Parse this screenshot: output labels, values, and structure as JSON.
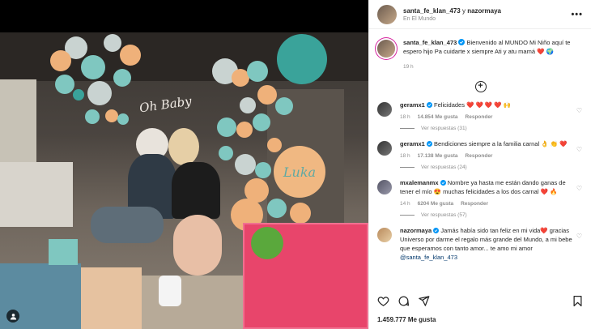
{
  "photo": {
    "sign_text": "Oh Baby",
    "balloon_name": "Luka"
  },
  "header": {
    "user_main": "santa_fe_klan_473",
    "joiner": "y",
    "user_collab": "nazormaya",
    "location": "En El Mundo",
    "more_icon": "more-horizontal-icon"
  },
  "caption": {
    "user": "santa_fe_klan_473",
    "verified_icon": "verified-badge-icon",
    "text": "Bienvenido al MUNDO Mi Niño aquí te espero hijo Pa cuidarte x siempre Ati y atu mamá ❤️ 🌍",
    "time": "19 h"
  },
  "load_more_icon": "plus-circle-icon",
  "comments": [
    {
      "user": "geramx1",
      "text": "Felicidades ❤️ ❤️ ❤️ ❤️ 🙌",
      "time": "18 h",
      "likes": "14.854 Me gusta",
      "reply": "Responder",
      "replies": "Ver respuestas (31)"
    },
    {
      "user": "geramx1",
      "text": "Bendiciones siempre a la familia carnal 👌 👏 ❤️",
      "time": "18 h",
      "likes": "17.138 Me gusta",
      "reply": "Responder",
      "replies": "Ver respuestas (24)"
    },
    {
      "user": "mxalemanmx",
      "text": "Nombre ya hasta me están dando ganas de tener el mío 😍 muchas felicidades a los dos carnal ❤️ 🔥",
      "time": "14 h",
      "likes": "6204 Me gusta",
      "reply": "Responder",
      "replies": "Ver respuestas (57)"
    },
    {
      "user": "nazormaya",
      "text": "Jamás había sido tan feliz en mi vida❤️ gracias Universo por darme el regalo más grande del Mundo, a mi bebe que esperamos con tanto amor... te amo mi amor",
      "mention": "@santa_fe_klan_473"
    }
  ],
  "actions": {
    "like_icon": "heart-icon",
    "comment_icon": "comment-icon",
    "share_icon": "share-icon",
    "save_icon": "bookmark-icon"
  },
  "likes_total": "1.459.777 Me gusta",
  "colors": {
    "text": "#262626",
    "muted": "#8e8e8e",
    "verified": "#0095f6",
    "mention": "#00376b"
  }
}
